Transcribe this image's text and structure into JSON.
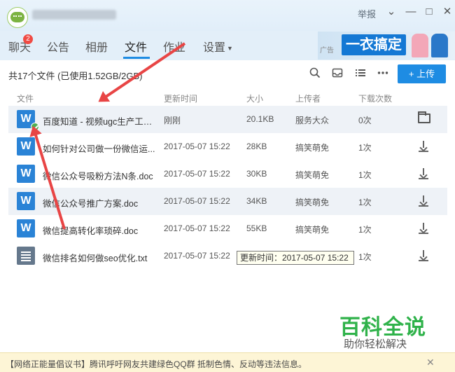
{
  "titlebar": {
    "report_label": "举报",
    "minimize": "—",
    "maximize": "□",
    "close": "✕"
  },
  "tabs": [
    {
      "label": "聊天",
      "badge": "2"
    },
    {
      "label": "公告"
    },
    {
      "label": "相册"
    },
    {
      "label": "文件",
      "active": true
    },
    {
      "label": "作业"
    },
    {
      "label": "设置"
    }
  ],
  "ad": {
    "tag": "广告",
    "text": "一衣搞定"
  },
  "toolbar": {
    "file_count": "共17个文件 (已使用1.52GB/2GB)",
    "upload_label": "上传",
    "upload_icon": "+"
  },
  "columns": [
    "文件",
    "更新时间",
    "大小",
    "上传者",
    "下载次数"
  ],
  "files": [
    {
      "name": "百度知道 - 视频ugc生产工作...",
      "time": "刚刚",
      "size": "20.1KB",
      "uploader": "服务大众",
      "downloads": "0次",
      "type": "doc",
      "action": "folder-icon"
    },
    {
      "name": "如何针对公司做一份微信运...",
      "time": "2017-05-07 15:22",
      "size": "28KB",
      "uploader": "搞笑萌免",
      "downloads": "1次",
      "type": "doc",
      "action": "download-icon"
    },
    {
      "name": "微信公众号吸粉方法N条.doc",
      "time": "2017-05-07 15:22",
      "size": "30KB",
      "uploader": "搞笑萌免",
      "downloads": "1次",
      "type": "doc",
      "action": "download-icon"
    },
    {
      "name": "微信公众号推广方案.doc",
      "time": "2017-05-07 15:22",
      "size": "34KB",
      "uploader": "搞笑萌免",
      "downloads": "1次",
      "type": "doc",
      "action": "download-icon"
    },
    {
      "name": "微信提高转化率琐碎.doc",
      "time": "2017-05-07 15:22",
      "size": "55KB",
      "uploader": "搞笑萌免",
      "downloads": "1次",
      "type": "doc",
      "action": "download-icon"
    },
    {
      "name": "微信排名如何做seo优化.txt",
      "time": "2017-05-07 15:22",
      "size": "",
      "uploader": "",
      "downloads": "1次",
      "type": "txt",
      "action": "download-icon"
    }
  ],
  "tooltip": "更新时间：2017-05-07 15:22",
  "watermark": {
    "title": "百科全说",
    "subtitle": "助你轻松解决"
  },
  "notice": {
    "text": "【网络正能量倡议书】腾讯呼吁网友共建绿色QQ群 抵制色情、反动等违法信息。",
    "close": "✕"
  },
  "colors": {
    "accent": "#1e8ce3",
    "arrow": "#e84545",
    "watermark": "#2fb24a"
  }
}
